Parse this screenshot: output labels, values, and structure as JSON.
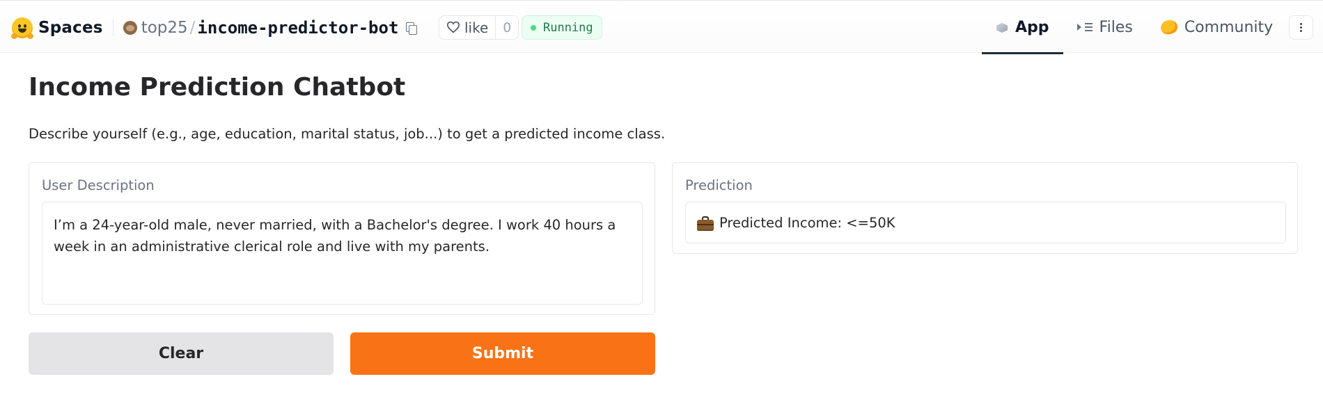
{
  "header": {
    "brand": "Spaces",
    "owner": "top25",
    "separator": "/",
    "repo": "income-predictor-bot",
    "like_label": "like",
    "like_count": "0",
    "status": "Running",
    "status_color": "#4ade80",
    "tabs": [
      {
        "label": "App",
        "icon": "cube-icon",
        "active": true
      },
      {
        "label": "Files",
        "icon": "files-icon",
        "active": false
      },
      {
        "label": "Community",
        "icon": "community-icon",
        "active": false
      }
    ],
    "more_icon": "more-vertical-icon"
  },
  "main": {
    "title": "Income Prediction Chatbot",
    "description": "Describe yourself (e.g., age, education, marital status, job...) to get a predicted income class.",
    "input_panel": {
      "label": "User Description",
      "value": "I’m a 24-year-old male, never married, with a Bachelor's degree. I work 40 hours a week in an administrative clerical role and live with my parents."
    },
    "output_panel": {
      "label": "Prediction",
      "value": "Predicted Income: <=50K",
      "icon": "briefcase-icon"
    },
    "buttons": {
      "clear": "Clear",
      "submit": "Submit"
    }
  },
  "colors": {
    "accent": "#f97316",
    "clear_button": "#e4e4e7"
  }
}
